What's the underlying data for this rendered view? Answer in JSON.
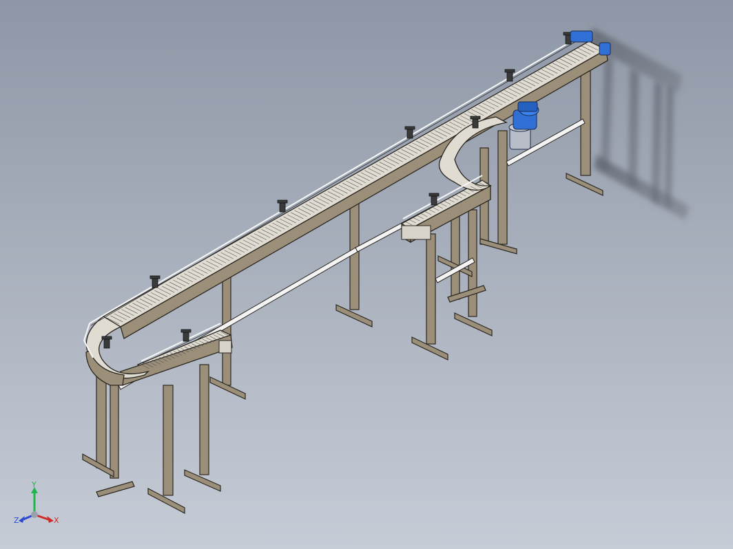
{
  "viewport": {
    "background_top": "#8e97a6",
    "background_bottom": "#c6ccd6"
  },
  "model": {
    "frame_color": "#9b8f79",
    "frame_edge": "#2a2620",
    "rail_color": "#f2f2f2",
    "chain_color": "#d9d9d9",
    "motor_color": "#2f6fd6"
  },
  "triad": {
    "x_label": "X",
    "y_label": "Y",
    "z_label": "Z",
    "x_color": "#d12a2a",
    "y_color": "#1fb64a",
    "z_color": "#2a4bd1"
  }
}
